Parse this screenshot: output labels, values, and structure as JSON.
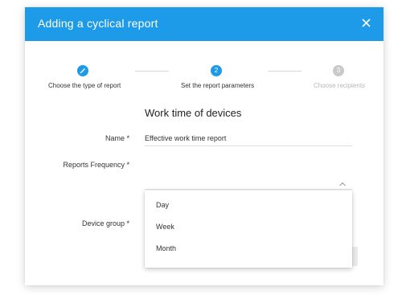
{
  "dialog": {
    "title": "Adding a cyclical report",
    "close_icon": "close-icon"
  },
  "stepper": {
    "steps": [
      {
        "number": "",
        "icon": "pencil-icon",
        "label": "Choose the type of report",
        "state": "completed"
      },
      {
        "number": "2",
        "label": "Set the report parameters",
        "state": "active"
      },
      {
        "number": "3",
        "label": "Choose recipients",
        "state": "inactive"
      }
    ]
  },
  "form": {
    "section_title": "Work time of devices",
    "name_label": "Name *",
    "name_value": "Effective work time report",
    "frequency_label": "Reports Frequency *",
    "frequency_icon": "chevron-up-icon",
    "device_group_label": "Device group *"
  },
  "dropdown": {
    "options": [
      "Day",
      "Week",
      "Month"
    ]
  },
  "colors": {
    "accent": "#1e9be8",
    "inactive_step": "#c9c9c9"
  }
}
